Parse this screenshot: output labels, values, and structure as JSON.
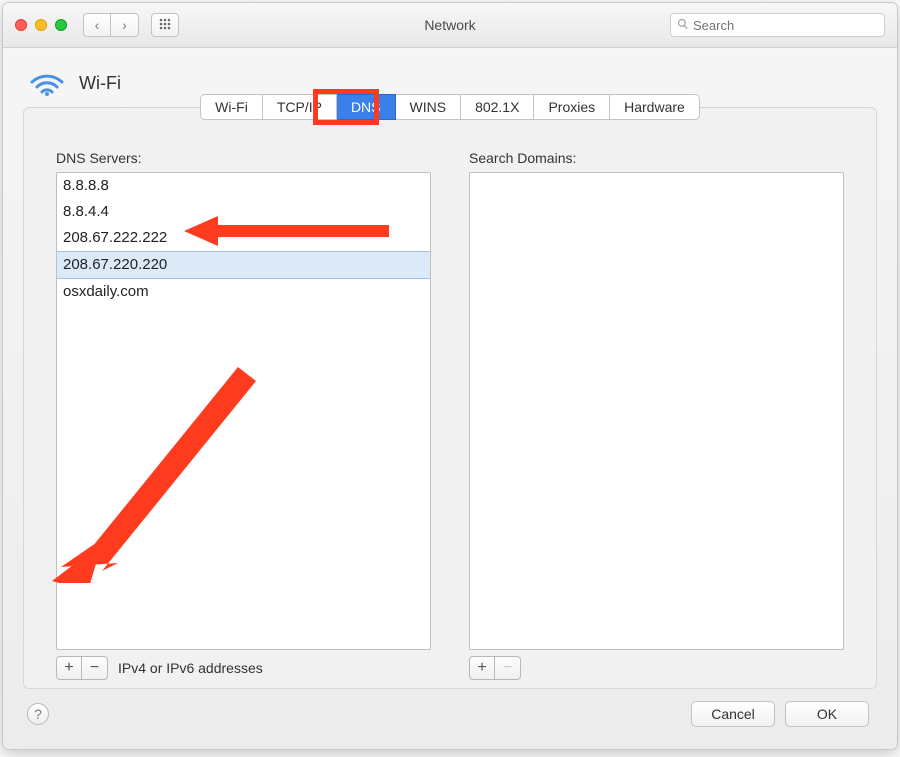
{
  "window": {
    "title": "Network",
    "search_placeholder": "Search"
  },
  "header": {
    "title": "Wi-Fi"
  },
  "tabs": [
    {
      "label": "Wi-Fi",
      "active": false
    },
    {
      "label": "TCP/IP",
      "active": false
    },
    {
      "label": "DNS",
      "active": true
    },
    {
      "label": "WINS",
      "active": false
    },
    {
      "label": "802.1X",
      "active": false
    },
    {
      "label": "Proxies",
      "active": false
    },
    {
      "label": "Hardware",
      "active": false
    }
  ],
  "dns": {
    "label": "DNS Servers:",
    "servers": [
      {
        "value": "8.8.8.8",
        "selected": false
      },
      {
        "value": "8.8.4.4",
        "selected": false
      },
      {
        "value": "208.67.222.222",
        "selected": false
      },
      {
        "value": "208.67.220.220",
        "selected": true
      },
      {
        "value": "osxdaily.com",
        "selected": false
      }
    ],
    "hint": "IPv4 or IPv6 addresses"
  },
  "search_domains": {
    "label": "Search Domains:",
    "items": []
  },
  "buttons": {
    "cancel": "Cancel",
    "ok": "OK"
  },
  "colors": {
    "accent": "#3b7fea",
    "annotation": "#ff3b1f"
  }
}
